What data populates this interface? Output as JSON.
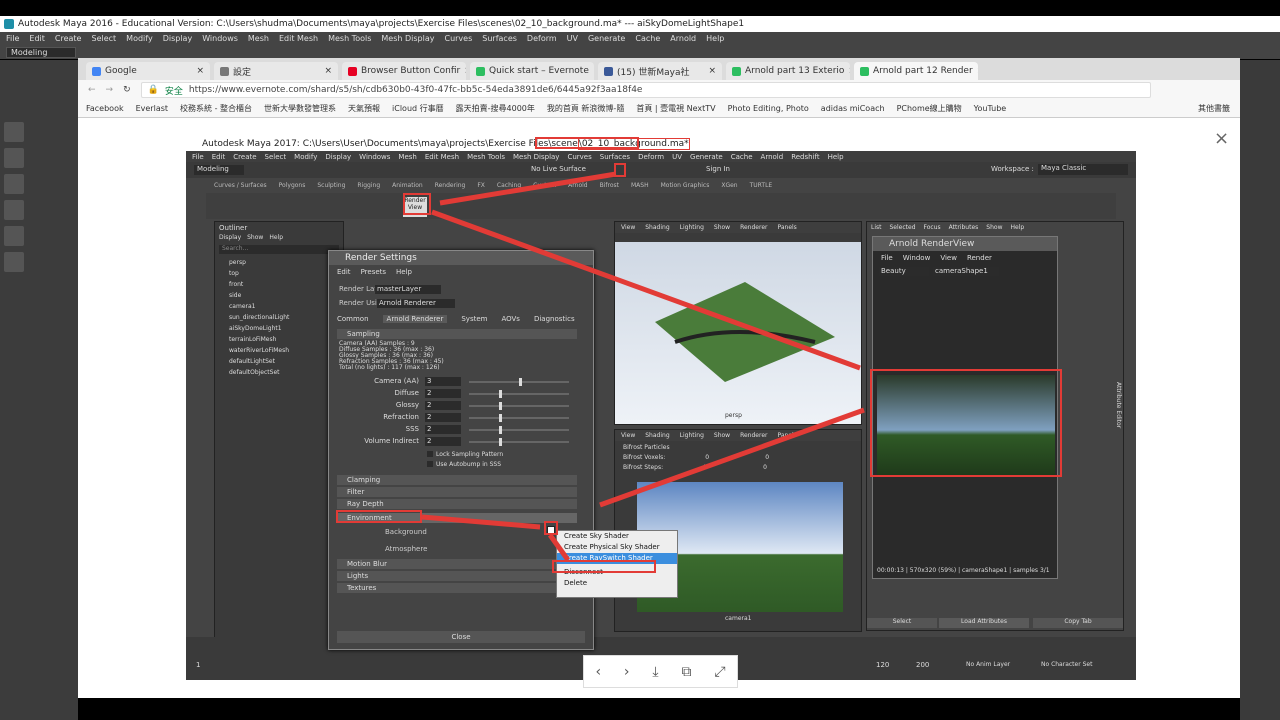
{
  "maya_window": {
    "title": "Autodesk Maya 2016 - Educational Version: C:\\Users\\shudma\\Documents\\maya\\projects\\Exercise Files\\scenes\\02_10_background.ma*   ---   aiSkyDomeLightShape1",
    "menu": [
      "File",
      "Edit",
      "Create",
      "Select",
      "Modify",
      "Display",
      "Windows",
      "Mesh",
      "Edit Mesh",
      "Mesh Tools",
      "Mesh Display",
      "Curves",
      "Surfaces",
      "Deform",
      "UV",
      "Generate",
      "Cache",
      "Arnold",
      "Help"
    ],
    "mode": "Modeling"
  },
  "browser": {
    "tabs": [
      {
        "label": "Google",
        "color": "#4285f4"
      },
      {
        "label": "設定",
        "color": "#777777"
      },
      {
        "label": "Browser Button Confir",
        "color": "#e60023"
      },
      {
        "label": "Quick start – Evernote",
        "color": "#2dbe60"
      },
      {
        "label": "(15) 世新Maya社",
        "color": "#3b5998"
      },
      {
        "label": "Arnold part 13 Exterio",
        "color": "#2dbe60"
      },
      {
        "label": "Arnold part 12 Render",
        "color": "#2dbe60"
      }
    ],
    "secure_label": "安全",
    "url": "https://www.evernote.com/shard/s5/sh/cdb630b0-43f0-47fc-bb5c-54eda3891de6/6445a92f3aa18f4e",
    "bookmarks": [
      "Facebook",
      "Everlast",
      "校務系統 - 整合櫃台",
      "世新大學數發管理系",
      "天氣預報",
      "iCloud 行事曆",
      "露天拍賣-搜尋4000年",
      "我的首頁 新浪微博-隨",
      "首頁 | 壹電視 NextTV",
      "Photo Editing, Photo",
      "adidas miCoach",
      "PChome線上購物",
      "YouTube"
    ],
    "bookmarks_more": "其他書籤",
    "close_icon": "×"
  },
  "inner": {
    "title_prefix": "Autodesk Maya 2017: C:\\Users\\User\\Documents\\maya\\projects\\Exercise Files\\scene",
    "title_file": "\\02_10_background.ma*",
    "menu": [
      "File",
      "Edit",
      "Create",
      "Select",
      "Modify",
      "Display",
      "Windows",
      "Mesh",
      "Edit Mesh",
      "Mesh Tools",
      "Mesh Display",
      "Curves",
      "Surfaces",
      "Deform",
      "UV",
      "Generate",
      "Cache",
      "Arnold",
      "Redshift",
      "Help"
    ],
    "workspace_label": "Workspace :",
    "workspace": "Maya Classic",
    "mode": "Modeling",
    "sign_in": "Sign In",
    "no_live": "No Live Surface",
    "shelf_tabs": [
      "Curves / Surfaces",
      "Polygons",
      "Sculpting",
      "Rigging",
      "Animation",
      "Rendering",
      "FX",
      "Caching",
      "Custom",
      "Arnold",
      "Bifrost",
      "MASH",
      "Motion Graphics",
      "XGen",
      "TURTLE"
    ],
    "render_view_label": "Render View",
    "outliner_title": "Outliner",
    "outliner_menu": [
      "Display",
      "Show",
      "Help"
    ],
    "outliner_search": "Search...",
    "outliner_items": [
      "persp",
      "top",
      "front",
      "side",
      "camera1",
      "sun_directionalLight",
      "aiSkyDomeLight1",
      "terrainLoFiMesh",
      "waterRiverLoFiMesh",
      "defaultLightSet",
      "defaultObjectSet"
    ],
    "vp_menu": [
      "View",
      "Shading",
      "Lighting",
      "Show",
      "Renderer",
      "Panels"
    ],
    "vp1_label": "persp",
    "vp2_label": "camera1",
    "vp2_stats": [
      [
        "Bifrost Particles",
        "",
        ""
      ],
      [
        "Bifrost Voxels:",
        "0",
        "0"
      ],
      [
        "Bifrost Steps:",
        "0",
        "0"
      ]
    ],
    "attr_menu": [
      "List",
      "Selected",
      "Focus",
      "Attributes",
      "Show",
      "Help"
    ],
    "attr_side": "Attribute Editor",
    "load_attributes": "Load Attributes",
    "select_label": "Select",
    "copy_tab": "Copy Tab",
    "timeline_start": "1",
    "timeline_end": "120",
    "range_end": "200",
    "no_anim_layer": "No Anim Layer",
    "no_char_set": "No Character Set"
  },
  "render_settings": {
    "title": "Render Settings",
    "menu": [
      "Edit",
      "Presets",
      "Help"
    ],
    "render_layer_label": "Render Layer",
    "render_layer": "masterLayer",
    "render_using_label": "Render Using",
    "render_using": "Arnold Renderer",
    "tabs": [
      "Common",
      "Arnold Renderer",
      "System",
      "AOVs",
      "Diagnostics"
    ],
    "sampling_header": "Sampling",
    "sample_info": [
      "Camera (AA) Samples : 9",
      "Diffuse Samples : 36 (max : 36)",
      "Glossy Samples : 36 (max : 36)",
      "Refraction Samples : 36 (max : 45)",
      "Total (no lights) : 117 (max : 126)"
    ],
    "fields": [
      {
        "label": "Camera (AA)",
        "value": "3",
        "slider": 0.5
      },
      {
        "label": "Diffuse",
        "value": "2",
        "slider": 0.3
      },
      {
        "label": "Glossy",
        "value": "2",
        "slider": 0.3
      },
      {
        "label": "Refraction",
        "value": "2",
        "slider": 0.3
      },
      {
        "label": "SSS",
        "value": "2",
        "slider": 0.3
      },
      {
        "label": "Volume Indirect",
        "value": "2",
        "slider": 0.3
      }
    ],
    "checks": [
      "Lock Sampling Pattern",
      "Use Autobump in SSS"
    ],
    "sections": [
      "Clamping",
      "Filter",
      "Ray Depth"
    ],
    "environment": "Environment",
    "background_label": "Background",
    "atmosphere_label": "Atmosphere",
    "more_sections": [
      "Motion Blur",
      "Lights",
      "Textures"
    ],
    "close_label": "Close"
  },
  "context_menu": [
    "Create Sky Shader",
    "Create Physical Sky Shader",
    "Create RaySwitch Shader",
    "Disconnect",
    "Delete"
  ],
  "arnold_view": {
    "title": "Arnold RenderView",
    "menu": [
      "File",
      "Window",
      "View",
      "Render"
    ],
    "aov": "Beauty",
    "camera": "cameraShape1",
    "status": "00:00:13 | 570x320 (59%) | cameraShape1 | samples 3/1"
  },
  "viewer_controls": [
    "‹",
    "›",
    "⤓",
    "⧉",
    "⤢"
  ],
  "colors": {
    "annotation": "#e23b36",
    "maya_bg": "#444444",
    "highlight": "#3b8ede"
  }
}
